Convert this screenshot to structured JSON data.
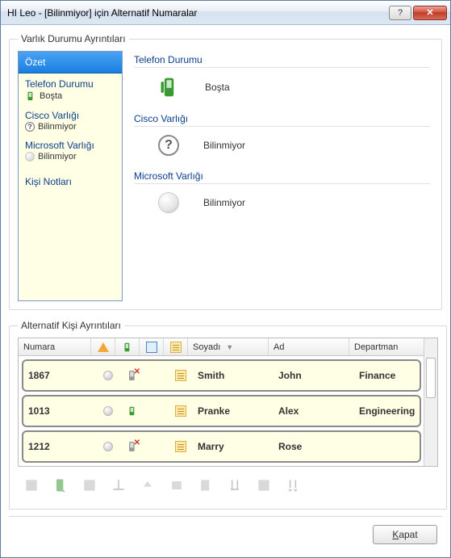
{
  "window": {
    "title": "HI Leo - [Bilinmiyor] için Alternatif Numaralar"
  },
  "groups": {
    "presence_title": "Varlık Durumu Ayrıntıları",
    "alt_title": "Alternatif Kişi Ayrıntıları"
  },
  "sidebar": {
    "items": [
      {
        "label": "Özet"
      },
      {
        "label": "Telefon Durumu",
        "sub": "Boşta"
      },
      {
        "label": "Cisco Varlığı",
        "sub": "Bilinmiyor"
      },
      {
        "label": "Microsoft Varlığı",
        "sub": "Bilinmiyor"
      },
      {
        "label": "Kişi Notları"
      }
    ]
  },
  "detail": {
    "sections": [
      {
        "title": "Telefon Durumu",
        "value": "Boşta"
      },
      {
        "title": "Cisco Varlığı",
        "value": "Bilinmiyor"
      },
      {
        "title": "Microsoft Varlığı",
        "value": "Bilinmiyor"
      }
    ]
  },
  "table": {
    "headers": {
      "number": "Numara",
      "lastname": "Soyadı",
      "firstname": "Ad",
      "department": "Departman"
    },
    "rows": [
      {
        "number": "1867",
        "lastname": "Smith",
        "firstname": "John",
        "department": "Finance",
        "phone_state": "x"
      },
      {
        "number": "1013",
        "lastname": "Pranke",
        "firstname": "Alex",
        "department": "Engineering",
        "phone_state": "ok"
      },
      {
        "number": "1212",
        "lastname": "Marry",
        "firstname": "Rose",
        "department": "",
        "phone_state": "x"
      }
    ]
  },
  "footer": {
    "close_prefix": "K",
    "close_rest": "apat"
  }
}
